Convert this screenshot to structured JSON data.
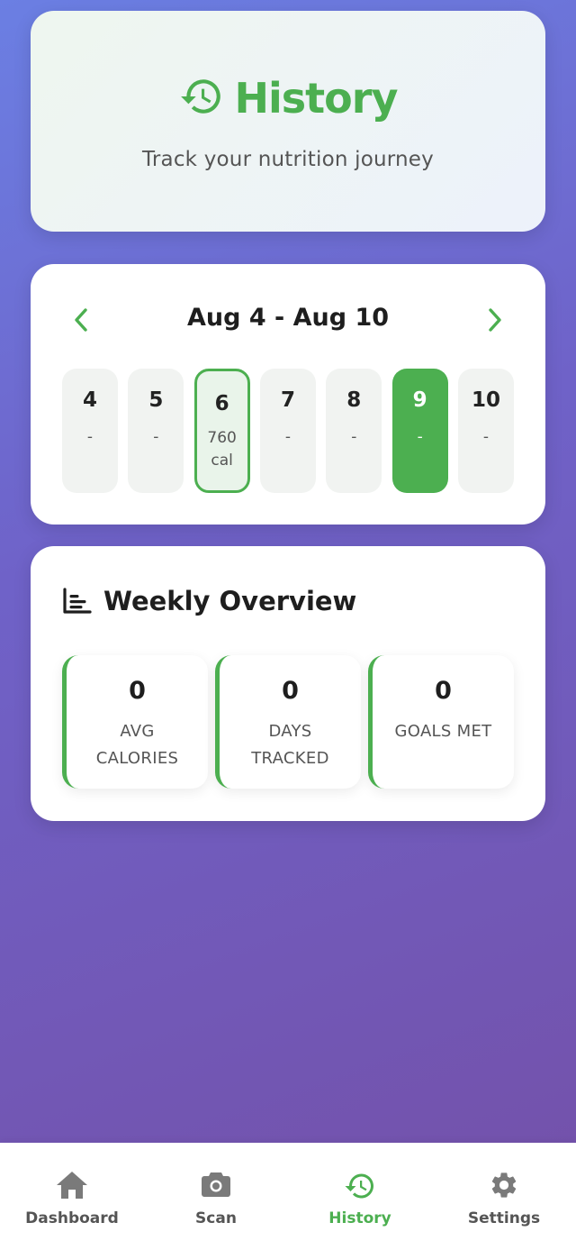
{
  "header": {
    "title": "History",
    "subtitle": "Track your nutrition journey",
    "icon": "history-icon"
  },
  "calendar": {
    "range_label": "Aug 4 - Aug 10",
    "days": [
      {
        "num": "4",
        "line1": "-",
        "line2": ""
      },
      {
        "num": "5",
        "line1": "-",
        "line2": ""
      },
      {
        "num": "6",
        "line1": "760",
        "line2": "cal"
      },
      {
        "num": "7",
        "line1": "-",
        "line2": ""
      },
      {
        "num": "8",
        "line1": "-",
        "line2": ""
      },
      {
        "num": "9",
        "line1": "-",
        "line2": ""
      },
      {
        "num": "10",
        "line1": "-",
        "line2": ""
      }
    ]
  },
  "overview": {
    "title": "Weekly Overview",
    "stats": [
      {
        "value": "0",
        "label_line1": "AVG",
        "label_line2": "CALORIES"
      },
      {
        "value": "0",
        "label_line1": "DAYS",
        "label_line2": "TRACKED"
      },
      {
        "value": "0",
        "label_line1": "GOALS MET",
        "label_line2": ""
      }
    ]
  },
  "nav": {
    "items": [
      {
        "label": "Dashboard",
        "icon": "home-icon"
      },
      {
        "label": "Scan",
        "icon": "camera-icon"
      },
      {
        "label": "History",
        "icon": "history-icon"
      },
      {
        "label": "Settings",
        "icon": "gear-icon"
      }
    ],
    "active": "History"
  },
  "colors": {
    "accent": "#4caf50",
    "text_dark": "#1e1e1e",
    "text_muted": "#555555",
    "day_bg": "#f1f3f1",
    "nav_inactive": "#7a7a7a"
  }
}
